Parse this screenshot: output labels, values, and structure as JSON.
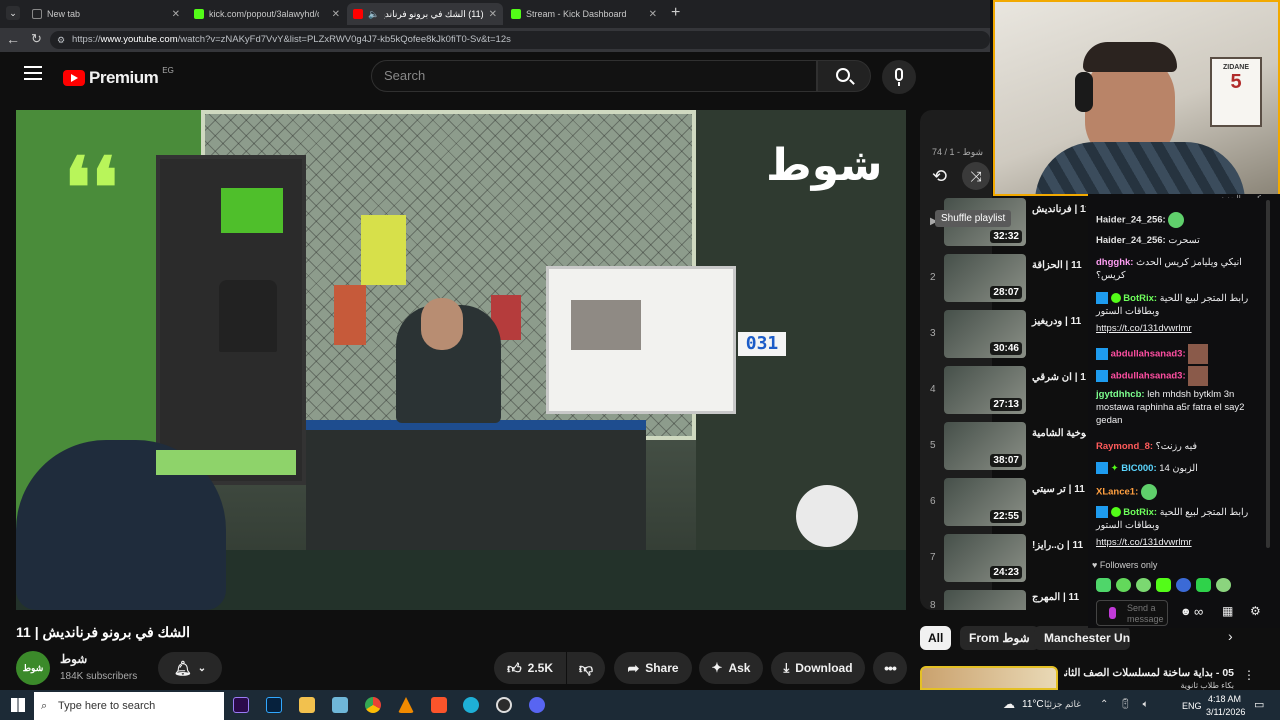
{
  "browser": {
    "tabs": [
      {
        "label": "New tab",
        "active": false
      },
      {
        "label": "kick.com/popout/3alawyhd/c",
        "active": false
      },
      {
        "label": "(11) الشك في برونو فرنانديش |",
        "active": true
      },
      {
        "label": "Stream - Kick Dashboard",
        "active": false
      }
    ],
    "url_prefix": "https://",
    "url_host": "www.youtube.com",
    "url_rest": "/watch?v=zNAKyFd7VvY&list=PLZxRWV0g4J7-kb5kQofee8kJk0fiT0-Sv&t=12s"
  },
  "youtube": {
    "logo": "Premium",
    "region": "EG",
    "search_placeholder": "Search",
    "video_logo_text": "شوط",
    "video_title": "الشك في برونو فرنانديش | 11",
    "channel_name": "شوط",
    "subscribers": "184K subscribers",
    "likes": "2.5K",
    "share": "Share",
    "ask": "Ask",
    "download": "Download",
    "chips": [
      "All",
      "From شوط",
      "Manchester United FC"
    ],
    "suggested_title": "05 - بداية ساخنة لمسلسلات الصف الثاني",
    "suggested_title_2": "بكاء طلاب ثانوية"
  },
  "playlist": {
    "counter": "شوط - 1 / 74",
    "tooltip": "Shuffle playlist",
    "items": [
      {
        "num": "▶",
        "duration": "32:32",
        "title": "11 | فرنانديش"
      },
      {
        "num": "2",
        "duration": "28:07",
        "title": "11 | الحزاقة"
      },
      {
        "num": "3",
        "duration": "30:46",
        "title": "11 | ودريغيز"
      },
      {
        "num": "4",
        "duration": "27:13",
        "title": "11 | ان شرقي"
      },
      {
        "num": "5",
        "duration": "38:07",
        "title": "11 | ملوخية الشامية"
      },
      {
        "num": "6",
        "duration": "22:55",
        "title": "11 | تر سيتي"
      },
      {
        "num": "7",
        "duration": "24:23",
        "title": "11 | ن..رايز!"
      },
      {
        "num": "8",
        "duration": "",
        "title": "11 | المهرج"
      }
    ]
  },
  "chat": {
    "top_partial": "كرس الحدث",
    "messages": [
      {
        "user": "Haider_24_256:",
        "text": "",
        "color": "#e3e3e3"
      },
      {
        "user": "Haider_24_256:",
        "text": "تسحرت",
        "color": "#e3e3e3"
      },
      {
        "user": "dhgghk:",
        "text": "انيكي ويليامز كريس الحدث كريس؟",
        "color": "#ff9ef3"
      },
      {
        "user": "BotRix:",
        "text": "رابط المتجر لبيع اللحية وبطاقات الستور",
        "color": "#6fff5c"
      },
      {
        "user": "",
        "text": "https://t.co/131dvwrlmr",
        "color": "#fff"
      },
      {
        "user": "abdullahsanad3:",
        "text": "",
        "color": "#ff4fa2"
      },
      {
        "user": "abdullahsanad3:",
        "text": "",
        "color": "#ff4fa2"
      },
      {
        "user": "jgytdhhcb:",
        "text": "leh mhdsh bytklm 3n mostawa raphinha a5r fatra el say2 gedan",
        "color": "#7dff8f"
      },
      {
        "user": "Raymond_8:",
        "text": "فيه رزنت؟",
        "color": "#ff5b5b"
      },
      {
        "user": "BIC000:",
        "text": "الزبون 14",
        "color": "#5bd6ff"
      },
      {
        "user": "XLance1:",
        "text": "",
        "color": "#ff9f40"
      },
      {
        "user": "BotRix:",
        "text": "رابط المتجر لبيع اللحية وبطاقات الستور",
        "color": "#6fff5c"
      },
      {
        "user": "",
        "text": "https://t.co/131dvwrlmr",
        "color": "#fff"
      }
    ],
    "followers_only": "Followers only",
    "send_placeholder": "Send a message"
  },
  "webcam": {
    "poster_name": "ZIDANE",
    "poster_num": "5"
  },
  "taskbar": {
    "search_placeholder": "Type here to search",
    "weather": "11°C",
    "weather_text": "غائم جزئيًا",
    "lang": "ENG",
    "time": "4:18 AM",
    "date": "3/11/2026"
  },
  "colors": {
    "yt_red": "#ff0000",
    "kick_green": "#53fc18",
    "cam_border": "#f2a900"
  }
}
